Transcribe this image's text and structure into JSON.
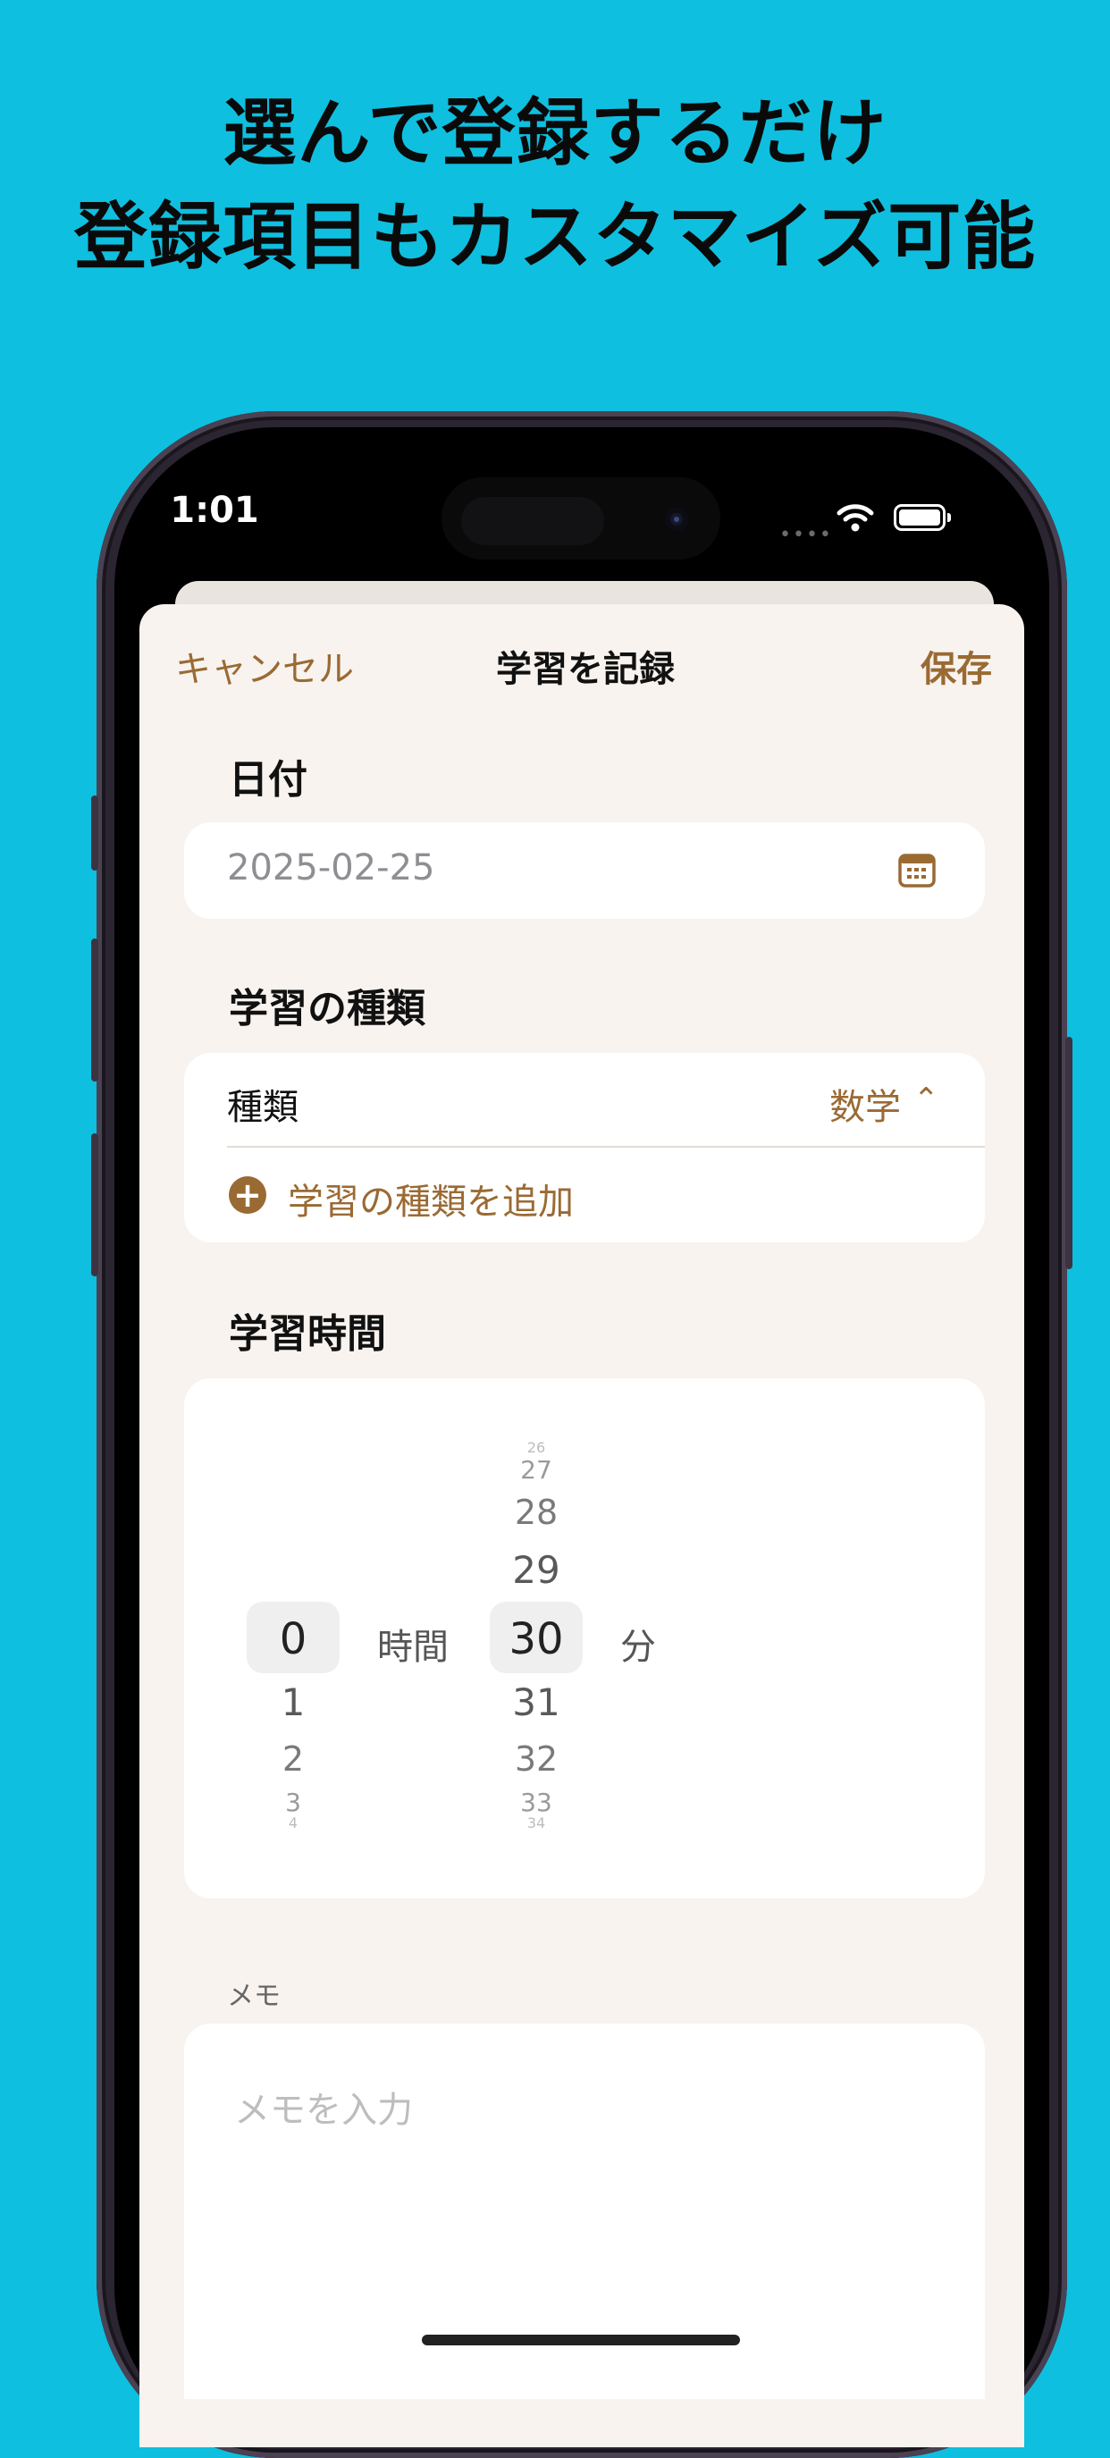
{
  "headline": {
    "line1": "選んで登録するだけ",
    "line2": "登録項目もカスタマイズ可能"
  },
  "status_bar": {
    "time": "1:01"
  },
  "nav": {
    "cancel": "キャンセル",
    "title": "学習を記録",
    "save": "保存"
  },
  "date_section": {
    "label": "日付",
    "value": "2025-02-25",
    "icon": "calendar-icon"
  },
  "type_section": {
    "label": "学習の種類",
    "row_label": "種類",
    "selected": "数学",
    "add_label": "学習の種類を追加",
    "add_icon": "plus-circle-icon"
  },
  "time_section": {
    "label": "学習時間",
    "hours": {
      "selected": "0",
      "unit": "時間",
      "below": [
        "1",
        "2",
        "3",
        "4"
      ]
    },
    "minutes": {
      "above": [
        "26",
        "27",
        "28",
        "29"
      ],
      "selected": "30",
      "unit": "分",
      "below": [
        "31",
        "32",
        "33",
        "34"
      ]
    }
  },
  "memo": {
    "label": "メモ",
    "placeholder": "メモを入力"
  },
  "colors": {
    "background": "#0fbfdf",
    "accent": "#9a6a33",
    "sheet": "#f8f3ef"
  }
}
